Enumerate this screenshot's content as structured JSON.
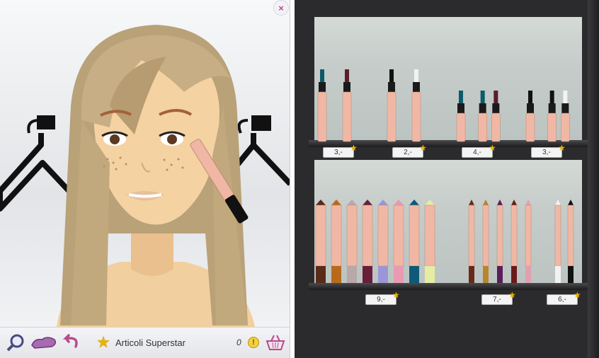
{
  "toolbar": {
    "shop_label": "Articoli Superstar",
    "coin_count": "0",
    "coin_symbol": "!",
    "icons": [
      "magnifier-icon",
      "shoe-icon",
      "undo-arrow-icon",
      "star-icon",
      "coin-icon",
      "basket-icon"
    ]
  },
  "close_button": {
    "label": "×"
  },
  "shelves": {
    "top": {
      "item_type": "mascara",
      "groups": [
        {
          "price": "3,-",
          "colors": [
            "#0e5a6a",
            "#5a1e2a"
          ]
        },
        {
          "price": "2,-",
          "colors": [
            "#111111",
            "#f2f2f2"
          ]
        },
        {
          "price": "4,-",
          "colors": [
            "#0e5a6a",
            "#0e5a6a",
            "#5a1e2a"
          ]
        },
        {
          "price": "3,-",
          "colors": [
            "#111111",
            "#111111",
            "#f2f2f2"
          ]
        }
      ]
    },
    "bottom": {
      "item_type": "pencil",
      "groups": [
        {
          "price": "9,-",
          "colors": [
            "#5a2a1a",
            "#b86a1c",
            "#b8a8a8",
            "#6a1e3a",
            "#9a96d8",
            "#e89ab2",
            "#0e5a7a",
            "#e6eca2"
          ]
        },
        {
          "price": "7,-",
          "colors": [
            "#6a2a1a",
            "#b8862a",
            "#5a1e5a",
            "#6a1a1a",
            "#e0a0b0"
          ]
        },
        {
          "price": "6,-",
          "colors": [
            "#f2f2f2",
            "#111111"
          ]
        }
      ]
    }
  },
  "colors": {
    "accent_pink": "#b84a8e",
    "star_gold": "#e9b400",
    "shelf_dark": "#2b2b2d",
    "product_peach": "#f0b8a4"
  }
}
